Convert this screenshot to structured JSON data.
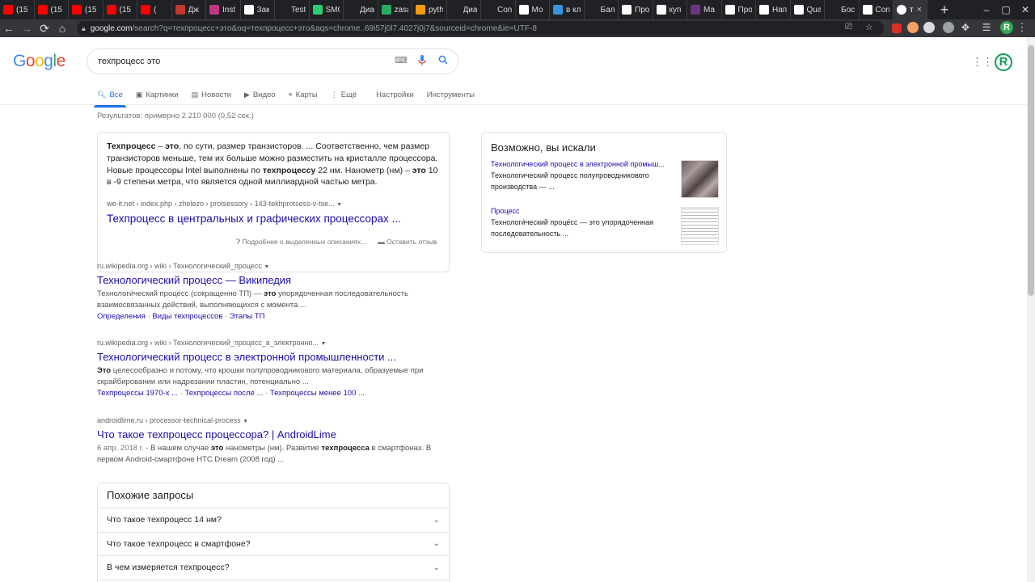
{
  "tabs": [
    {
      "title": "(15",
      "color": "#ff0000"
    },
    {
      "title": "(15",
      "color": "#ff0000"
    },
    {
      "title": "(15",
      "color": "#ff0000"
    },
    {
      "title": "(15",
      "color": "#ff0000"
    },
    {
      "title": "(",
      "color": "#ff0000"
    },
    {
      "title": "Дж",
      "color": "#c0392b"
    },
    {
      "title": "Inst",
      "color": "#c13584"
    },
    {
      "title": "Зак",
      "color": "#ffffff"
    },
    {
      "title": "Test",
      "color": "#202124"
    },
    {
      "title": "SMG",
      "color": "#2ecc71"
    },
    {
      "title": "Диа",
      "color": "#202124"
    },
    {
      "title": "zasa",
      "color": "#27ae60"
    },
    {
      "title": "pyth",
      "color": "#f39c12"
    },
    {
      "title": "Диа",
      "color": "#202124"
    },
    {
      "title": "Con",
      "color": "#202124"
    },
    {
      "title": "Мо",
      "color": "#ffffff"
    },
    {
      "title": "в кл",
      "color": "#3498db"
    },
    {
      "title": "Бал",
      "color": "#202124"
    },
    {
      "title": "Про",
      "color": "#ffffff"
    },
    {
      "title": "куп",
      "color": "#ffffff"
    },
    {
      "title": "Ма",
      "color": "#6c3483"
    },
    {
      "title": "Про",
      "color": "#ffffff"
    },
    {
      "title": "Нап",
      "color": "#ffffff"
    },
    {
      "title": "Qua",
      "color": "#ffffff"
    },
    {
      "title": "Бос",
      "color": "#202124"
    },
    {
      "title": "Con",
      "color": "#ffffff"
    }
  ],
  "active_tab": {
    "title": "т",
    "close": "×"
  },
  "new_tab_label": "+",
  "window_controls": {
    "minimize": "–",
    "maximize": "▢",
    "close": "✕"
  },
  "url": {
    "host": "google.com",
    "path": "/search?q=техпроцесс+это&oq=техпроцесс+это&aqs=chrome..69i57j0l7.4027j0j7&sourceid=chrome&ie=UTF-8"
  },
  "profile_chip": "R",
  "logo": [
    {
      "ch": "G",
      "color": "#4285f4"
    },
    {
      "ch": "o",
      "color": "#ea4335"
    },
    {
      "ch": "o",
      "color": "#fbbc05"
    },
    {
      "ch": "g",
      "color": "#4285f4"
    },
    {
      "ch": "l",
      "color": "#34a853"
    },
    {
      "ch": "e",
      "color": "#ea4335"
    }
  ],
  "search": {
    "query": "техпроцесс это"
  },
  "avatar_letter": "R",
  "nav_tabs": [
    {
      "label": "Все",
      "icon": "search-icon",
      "active": true
    },
    {
      "label": "Картинки",
      "icon": "image-icon"
    },
    {
      "label": "Новости",
      "icon": "news-icon"
    },
    {
      "label": "Видео",
      "icon": "video-icon"
    },
    {
      "label": "Карты",
      "icon": "map-pin-icon"
    },
    {
      "label": "Ещё",
      "icon": "more-vert-icon"
    },
    {
      "label": "Настройки"
    },
    {
      "label": "Инструменты"
    }
  ],
  "stats": "Результатов: примерно 2 210 000 (0,52 сек.)",
  "featured_snippet": {
    "cite": "we-it.net › index.php › zhelezo › protsessory › 143-tekhprotsess-v-tse...",
    "title": "Техпроцесс в центральных и графических процессорах ...",
    "footer_about": "Подробнее о выделенных описаниях...",
    "footer_feedback": "Оставить отзыв"
  },
  "results": [
    {
      "cite": "ru.wikipedia.org › wiki › Технологический_процесс",
      "title": "Технологический процесс — Википедия",
      "sitelinks": [
        "Определения",
        "Виды техпроцессов",
        "Этапы ТП"
      ]
    },
    {
      "cite": "ru.wikipedia.org › wiki › Технологический_процесс_в_электронно...",
      "title": "Технологический процесс в электронной промышленности ...",
      "sitelinks": [
        "Техпроцессы 1970-х ...",
        "Техпроцессы после ...",
        "Техпроцессы менее 100 ..."
      ]
    },
    {
      "cite": "androidlime.ru › processor-technical-process",
      "title": "Что такое техпроцесс процессора? | AndroidLime",
      "date": "6 апр. 2018 г. - "
    }
  ],
  "related": {
    "heading": "Похожие запросы",
    "items": [
      "Что такое техпроцесс 14 нм?",
      "Что такое техпроцесс в смартфоне?",
      "В чем измеряется техпроцесс?"
    ]
  },
  "side_panel": {
    "heading": "Возможно, вы искали",
    "items": [
      {
        "title": "Технологический процесс в электронной промыш...",
        "desc": "Технологический процесс полупроводникового производства — ..."
      },
      {
        "title": "Процесс",
        "desc": "Технологи́ческий проце́сс — это упорядоченная последовательность ..."
      }
    ]
  }
}
